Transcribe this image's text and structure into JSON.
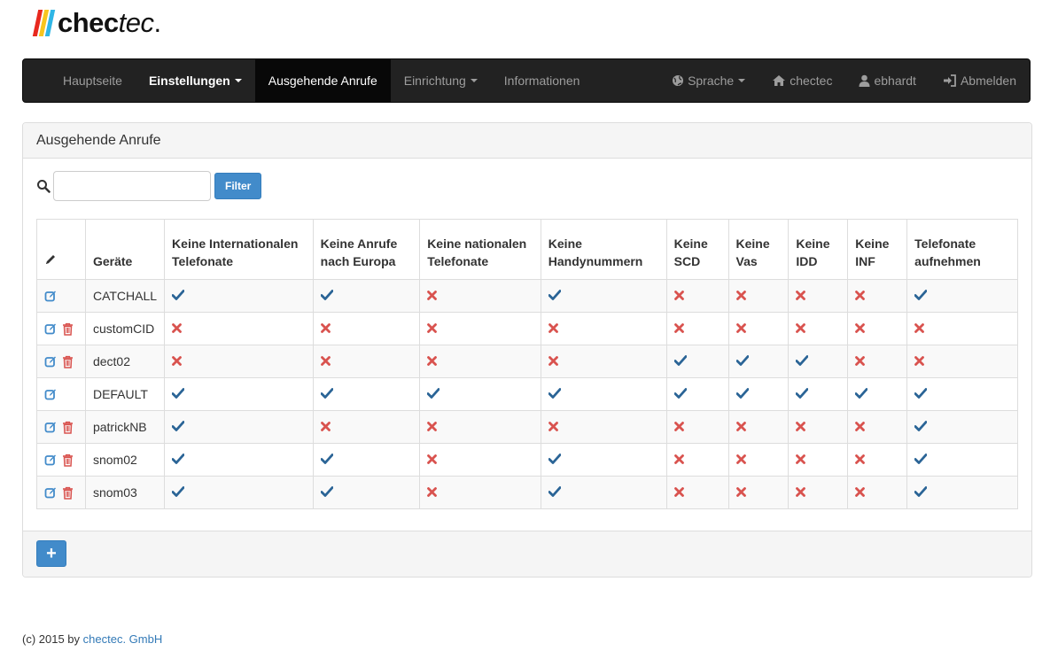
{
  "logo": {
    "bold": "chec",
    "italic": "tec",
    "suffix": ".",
    "stripes": [
      "#e8281e",
      "#f7c51e",
      "#2fb6e6"
    ]
  },
  "nav": {
    "left": [
      {
        "label": "Hauptseite",
        "style": "normal",
        "caret": false
      },
      {
        "label": "Einstellungen",
        "style": "bold",
        "caret": true
      },
      {
        "label": "Ausgehende Anrufe",
        "style": "active",
        "caret": false
      },
      {
        "label": "Einrichtung",
        "style": "normal",
        "caret": true
      },
      {
        "label": "Informationen",
        "style": "normal",
        "caret": false
      }
    ],
    "right": [
      {
        "label": "Sprache",
        "icon": "globe-icon",
        "caret": true
      },
      {
        "label": "chectec",
        "icon": "home-icon",
        "caret": false
      },
      {
        "label": "ebhardt",
        "icon": "user-icon",
        "caret": false
      },
      {
        "label": "Abmelden",
        "icon": "log-in-icon",
        "caret": false
      }
    ]
  },
  "panel": {
    "title": "Ausgehende Anrufe"
  },
  "filter": {
    "value": "",
    "placeholder": "",
    "button_label": "Filter"
  },
  "table": {
    "headers": [
      "",
      "Geräte",
      "Keine Internationalen Telefonate",
      "Keine Anrufe nach Europa",
      "Keine nationalen Telefonate",
      "Keine Handynummern",
      "Keine SCD",
      "Keine Vas",
      "Keine IDD",
      "Keine INF",
      "Telefonate aufnehmen"
    ],
    "rows": [
      {
        "device": "CATCHALL",
        "deletable": false,
        "flags": [
          true,
          true,
          false,
          true,
          false,
          false,
          false,
          false,
          true
        ]
      },
      {
        "device": "customCID",
        "deletable": true,
        "flags": [
          false,
          false,
          false,
          false,
          false,
          false,
          false,
          false,
          false
        ]
      },
      {
        "device": "dect02",
        "deletable": true,
        "flags": [
          false,
          false,
          false,
          false,
          true,
          true,
          true,
          false,
          false
        ]
      },
      {
        "device": "DEFAULT",
        "deletable": false,
        "flags": [
          true,
          true,
          true,
          true,
          true,
          true,
          true,
          true,
          true
        ]
      },
      {
        "device": "patrickNB",
        "deletable": true,
        "flags": [
          true,
          false,
          false,
          false,
          false,
          false,
          false,
          false,
          true
        ]
      },
      {
        "device": "snom02",
        "deletable": true,
        "flags": [
          true,
          true,
          false,
          true,
          false,
          false,
          false,
          false,
          true
        ]
      },
      {
        "device": "snom03",
        "deletable": true,
        "flags": [
          true,
          true,
          false,
          true,
          false,
          false,
          false,
          false,
          true
        ]
      }
    ]
  },
  "add_button": {
    "label": "+"
  },
  "footer": {
    "prefix": "(c) 2015 by ",
    "company": "chectec. GmbH"
  },
  "colors": {
    "check": "#2a6496",
    "cross": "#d9534f",
    "edit": "#428bca",
    "trash": "#d9534f"
  }
}
